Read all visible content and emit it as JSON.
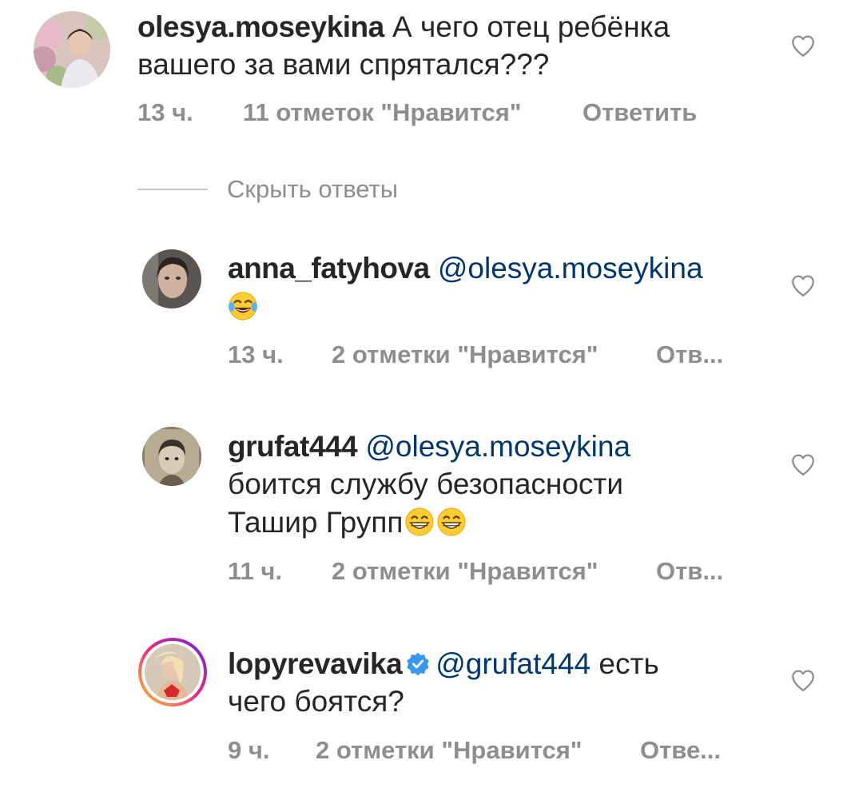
{
  "comments": [
    {
      "username": "olesya.moseykina",
      "text_line1": "А чего отец ребёнка",
      "text_line2": "вашего за вами спрятался???",
      "time": "13 ч.",
      "likes": "11 отметок \"Нравится\"",
      "reply": "Ответить"
    },
    {
      "username": "anna_fatyhova",
      "mention": "@olesya.moseykina",
      "time": "13 ч.",
      "likes": "2 отметки \"Нравится\"",
      "reply": "Отв..."
    },
    {
      "username": "grufat444",
      "mention": "@olesya.moseykina",
      "text_line2": "боится службу безопасности",
      "text_line3": "Ташир Групп",
      "time": "11 ч.",
      "likes": "2 отметки \"Нравится\"",
      "reply": "Отв..."
    },
    {
      "username": "lopyrevavika",
      "mention": "@grufat444",
      "text_after_mention": " есть",
      "text_line2": "чего боятся?",
      "time": "9 ч.",
      "likes": "2 отметки \"Нравится\"",
      "reply": "Отве..."
    }
  ],
  "hide_replies": "Скрыть ответы",
  "icons": {
    "like": "heart-outline-icon",
    "emoji_laugh": "face-with-tears-of-joy-emoji",
    "emoji_grin": "grinning-face-emoji",
    "verified": "verified-badge-icon"
  },
  "colors": {
    "text": "#262626",
    "meta": "#8e8e8e",
    "mention": "#00376b",
    "verified": "#3897f0"
  }
}
